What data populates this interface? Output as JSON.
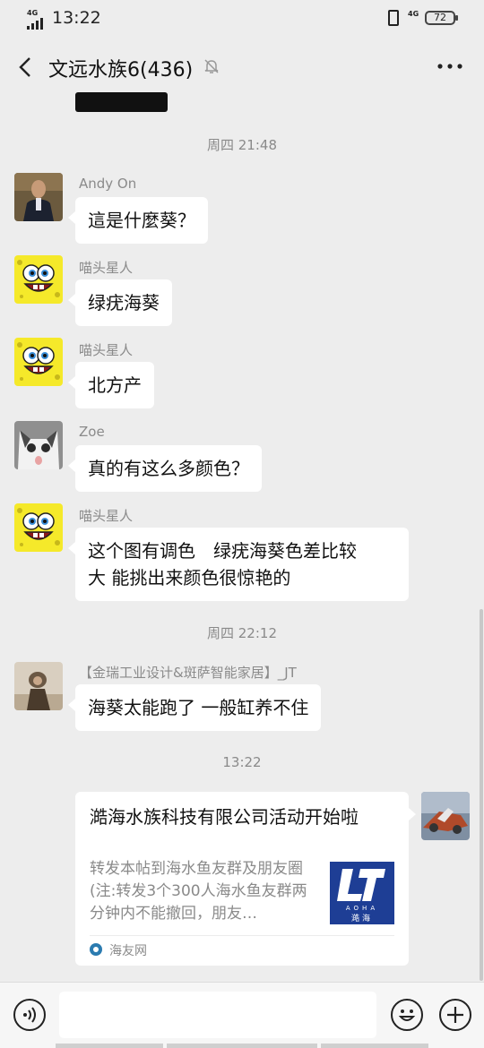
{
  "status_bar": {
    "network": "4G",
    "network2": "4G",
    "time": "13:22",
    "battery": "72"
  },
  "nav": {
    "back_icon": "chevron-left-icon",
    "title": "文远水族6(436)",
    "mute_icon": "bell-off-icon",
    "more_label": "···"
  },
  "timestamps": [
    "周四 21:48",
    "周四 22:12",
    "13:22"
  ],
  "messages": [
    {
      "sender": "Andy On",
      "text": "這是什麼葵？"
    },
    {
      "sender": "喵头星人",
      "text": "绿疣海葵"
    },
    {
      "sender": "喵头星人",
      "text": "北方产"
    },
    {
      "sender": "Zoe",
      "text": "真的有这么多颜色？"
    },
    {
      "sender": "喵头星人",
      "text_line1": "这个图有调色　绿疣海葵色差比较",
      "text_line2": "大 能挑出来颜色很惊艳的"
    },
    {
      "sender": "【金瑞工业设计&斑萨智能家居】_JT",
      "text": "海葵太能跑了 一般缸养不住"
    }
  ],
  "link_card": {
    "title": "澔海水族科技有限公司活动开始啦",
    "description": "转发本帖到海水鱼友群及朋友圈(注:转发3个300人海水鱼友群两分钟内不能撤回，朋友…",
    "logo_text": "AOHA",
    "logo_cn": "澔海",
    "source": "海友网"
  },
  "input_bar": {
    "voice_icon": "voice-icon",
    "emoji_icon": "emoji-icon",
    "plus_icon": "plus-icon"
  },
  "colors": {
    "background": "#ededed",
    "bubble": "#ffffff",
    "timestamp": "#8a8a8a",
    "logo_blue": "#1e3e95"
  }
}
